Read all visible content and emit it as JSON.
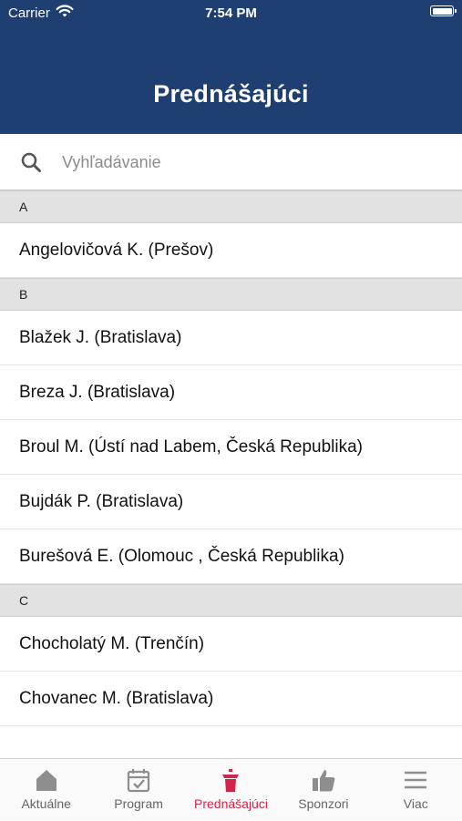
{
  "status_bar": {
    "carrier": "Carrier",
    "time": "7:54 PM"
  },
  "header": {
    "title": "Prednášajúci"
  },
  "search": {
    "placeholder": "Vyhľadávanie"
  },
  "list": [
    {
      "type": "section",
      "label": "A"
    },
    {
      "type": "item",
      "label": "Angelovičová K. (Prešov)"
    },
    {
      "type": "section",
      "label": "B"
    },
    {
      "type": "item",
      "label": "Blažek J. (Bratislava)"
    },
    {
      "type": "item",
      "label": "Breza J. (Bratislava)"
    },
    {
      "type": "item",
      "label": "Broul M. (Ústí nad Labem, Česká Republika)"
    },
    {
      "type": "item",
      "label": "Bujdák P. (Bratislava)"
    },
    {
      "type": "item",
      "label": "Burešová E. (Olomouc , Česká Republika)"
    },
    {
      "type": "section",
      "label": "C"
    },
    {
      "type": "item",
      "label": "Chocholatý M. (Trenčín)"
    },
    {
      "type": "item",
      "label": "Chovanec M. (Bratislava)"
    }
  ],
  "tabbar": {
    "active_color": "#d6234a",
    "inactive_color": "#666666",
    "tabs": [
      {
        "label": "Aktuálne",
        "icon": "home-icon",
        "active": false
      },
      {
        "label": "Program",
        "icon": "calendar-icon",
        "active": false
      },
      {
        "label": "Prednášajúci",
        "icon": "podium-icon",
        "active": true
      },
      {
        "label": "Sponzori",
        "icon": "thumbs-up-icon",
        "active": false
      },
      {
        "label": "Viac",
        "icon": "menu-icon",
        "active": false
      }
    ]
  },
  "colors": {
    "header_bg": "#1f3f73",
    "section_bg": "#e2e2e2"
  }
}
